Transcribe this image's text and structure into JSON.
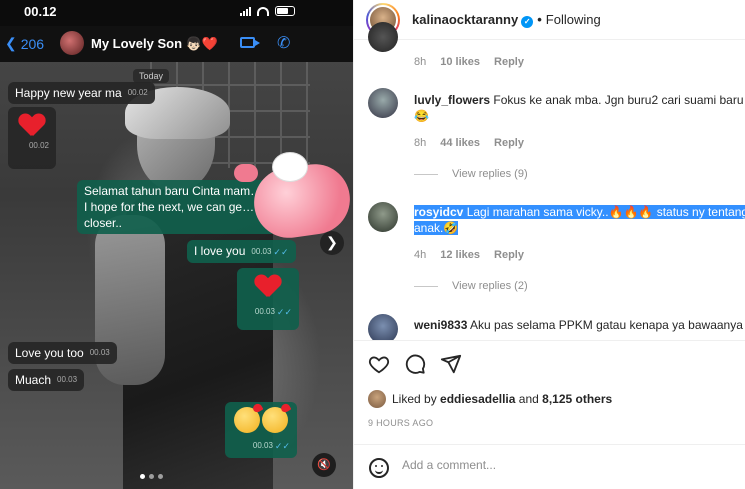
{
  "phone": {
    "status_time": "00.12",
    "back_count": "206",
    "chat_name": "My Lovely Son 👦🏻❤️",
    "date_chip": "Today",
    "messages": [
      {
        "text": "Happy new year ma",
        "time": "00.02",
        "dir": "in"
      },
      {
        "text": "",
        "time": "00.02",
        "dir": "in",
        "kind": "heart"
      },
      {
        "text": "Selamat tahun baru Cinta mam…",
        "text2": "I hope for the next, we can ge…",
        "text3": "closer..",
        "time": "",
        "dir": "out"
      },
      {
        "text": "I love you",
        "time": "00.03",
        "dir": "out"
      },
      {
        "text": "",
        "time": "00.03",
        "dir": "out",
        "kind": "heart"
      },
      {
        "text": "Love you too",
        "time": "00.03",
        "dir": "in"
      },
      {
        "text": "Muach",
        "time": "00.03",
        "dir": "in"
      },
      {
        "text": "",
        "time": "00.03",
        "dir": "out",
        "kind": "kiss-emojis"
      }
    ],
    "mute_icon": "speaker-muted-icon",
    "carousel_dots": 3
  },
  "post": {
    "username": "kalinaocktaranny",
    "separator": "•",
    "follow_label": "Following"
  },
  "comments": [
    {
      "user": "",
      "text": "",
      "time": "8h",
      "likes": "10 likes",
      "reply": "Reply"
    },
    {
      "user": "luvly_flowers",
      "text": "Fokus ke anak mba. Jgn buru2 cari suami baru",
      "emoji": "😂",
      "time": "8h",
      "likes": "44 likes",
      "reply": "Reply",
      "view_replies": "View replies (9)"
    },
    {
      "user": "rosyidcv",
      "text": "Lagi marahan sama vicky..🔥🔥🔥 status ny tentang",
      "text2": "anak.🤣",
      "time": "4h",
      "likes": "12 likes",
      "reply": "Reply",
      "view_replies": "View replies (2)"
    },
    {
      "user": "weni9833",
      "text": "Aku pas selama PPKM gatau kenapa ya bawaanya"
    }
  ],
  "actions": {
    "liked_by_prefix": "Liked by",
    "liked_by_user": "eddiesadellia",
    "liked_by_mid": "and",
    "liked_by_count": "8,125 others",
    "time_ago": "9 HOURS AGO",
    "add_comment_placeholder": "Add a comment..."
  },
  "colors": {
    "ig_blue": "#0095f6",
    "wa_out_bubble": "#10604c",
    "wa_in_bubble": "#262626",
    "selection": "#3390ff"
  }
}
